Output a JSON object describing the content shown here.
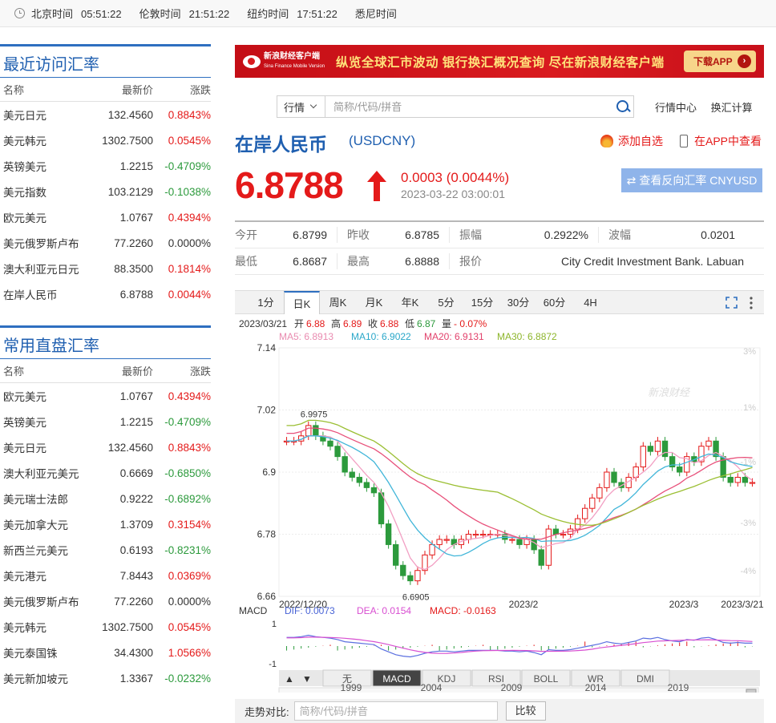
{
  "clock": [
    {
      "city": "北京时间",
      "time": "05:51:22"
    },
    {
      "city": "伦敦时间",
      "time": "21:51:22"
    },
    {
      "city": "纽约时间",
      "time": "17:51:22"
    },
    {
      "city": "悉尼时间",
      "time": ""
    }
  ],
  "recent": {
    "title": "最近访问汇率",
    "headers": [
      "名称",
      "最新价",
      "涨跌"
    ],
    "rows": [
      {
        "name": "美元日元",
        "price": "132.4560",
        "change": "0.8843%",
        "dir": "up"
      },
      {
        "name": "美元韩元",
        "price": "1302.7500",
        "change": "0.0545%",
        "dir": "up"
      },
      {
        "name": "英镑美元",
        "price": "1.2215",
        "change": "-0.4709%",
        "dir": "down"
      },
      {
        "name": "美元指数",
        "price": "103.2129",
        "change": "-0.1038%",
        "dir": "down"
      },
      {
        "name": "欧元美元",
        "price": "1.0767",
        "change": "0.4394%",
        "dir": "up"
      },
      {
        "name": "美元俄罗斯卢布",
        "price": "77.2260",
        "change": "0.0000%",
        "dir": "flat"
      },
      {
        "name": "澳大利亚元日元",
        "price": "88.3500",
        "change": "0.1814%",
        "dir": "up"
      },
      {
        "name": "在岸人民币",
        "price": "6.8788",
        "change": "0.0044%",
        "dir": "up"
      }
    ]
  },
  "common": {
    "title": "常用直盘汇率",
    "headers": [
      "名称",
      "最新价",
      "涨跌"
    ],
    "rows": [
      {
        "name": "欧元美元",
        "price": "1.0767",
        "change": "0.4394%",
        "dir": "up"
      },
      {
        "name": "英镑美元",
        "price": "1.2215",
        "change": "-0.4709%",
        "dir": "down"
      },
      {
        "name": "美元日元",
        "price": "132.4560",
        "change": "0.8843%",
        "dir": "up"
      },
      {
        "name": "澳大利亚元美元",
        "price": "0.6669",
        "change": "-0.6850%",
        "dir": "down"
      },
      {
        "name": "美元瑞士法郎",
        "price": "0.9222",
        "change": "-0.6892%",
        "dir": "down"
      },
      {
        "name": "美元加拿大元",
        "price": "1.3709",
        "change": "0.3154%",
        "dir": "up"
      },
      {
        "name": "新西兰元美元",
        "price": "0.6193",
        "change": "-0.8231%",
        "dir": "down"
      },
      {
        "name": "美元港元",
        "price": "7.8443",
        "change": "0.0369%",
        "dir": "up"
      },
      {
        "name": "美元俄罗斯卢布",
        "price": "77.2260",
        "change": "0.0000%",
        "dir": "flat"
      },
      {
        "name": "美元韩元",
        "price": "1302.7500",
        "change": "0.0545%",
        "dir": "up"
      },
      {
        "name": "美元泰国铢",
        "price": "34.4300",
        "change": "1.0566%",
        "dir": "up"
      },
      {
        "name": "美元新加坡元",
        "price": "1.3367",
        "change": "-0.0232%",
        "dir": "down"
      }
    ]
  },
  "banner": {
    "logo_line1": "新浪财经客户端",
    "logo_line2": "Sina Finance Mobile Version",
    "slogan": "纵览全球汇市波动 银行换汇概况查询 尽在新浪财经客户端",
    "download": "下载APP"
  },
  "search": {
    "select_label": "行情",
    "placeholder": "简称/代码/拼音",
    "link1": "行情中心",
    "link2": "换汇计算"
  },
  "quote": {
    "name": "在岸人民币",
    "code": "(USDCNY)",
    "add_fav": "添加自选",
    "app_view": "在APP中查看",
    "price": "6.8788",
    "change": "0.0003 (0.0044%)",
    "timestamp": "2023-03-22 03:00:01",
    "reverse_button": "查看反向汇率 CNYUSD"
  },
  "stats": {
    "row1": [
      {
        "label": "今开",
        "value": "6.8799"
      },
      {
        "label": "昨收",
        "value": "6.8785"
      },
      {
        "label": "振幅",
        "value": "0.2922%"
      },
      {
        "label": "波幅",
        "value": "0.0201"
      }
    ],
    "row2": [
      {
        "label": "最低",
        "value": "6.8687"
      },
      {
        "label": "最高",
        "value": "6.8888"
      },
      {
        "label": "报价",
        "value": "City Credit Investment Bank. Labuan"
      }
    ]
  },
  "chart_tabs": [
    "1分",
    "日K",
    "周K",
    "月K",
    "年K",
    "5分",
    "15分",
    "30分",
    "60分",
    "4H"
  ],
  "chart_active_tab": "日K",
  "chart_info": {
    "date": "2023/03/21",
    "open_label": "开",
    "open": "6.88",
    "high_label": "高",
    "high": "6.89",
    "close_label": "收",
    "close": "6.88",
    "low_label": "低",
    "low": "6.87",
    "amount_label": "量",
    "amount": "- 0.07%",
    "ma5": "MA5: 6.8913",
    "ma10": "MA10: 6.9022",
    "ma20": "MA20: 6.9131",
    "ma30": "MA30: 6.8872",
    "macd_title": "MACD",
    "dif": "DIF: 0.0073",
    "dea": "DEA: 0.0154",
    "macd": "MACD: -0.0163",
    "watermark": "新浪财经"
  },
  "indicator_tabs": [
    "无",
    "MACD",
    "KDJ",
    "RSI",
    "BOLL",
    "WR",
    "DMI"
  ],
  "indicator_active": "MACD",
  "compare": {
    "label": "走势对比:",
    "placeholder": "简称/代码/拼音",
    "button": "比较"
  },
  "chart_data": {
    "type": "line",
    "title": "",
    "y_ticks": [
      "7.14",
      "7.02",
      "6.9",
      "6.78",
      "6.66"
    ],
    "right_ticks": [
      "3%",
      "1%",
      "-1%",
      "-3%",
      "-4%"
    ],
    "x_ticks": [
      "2022/12/20",
      "2023/2",
      "2023/3",
      "2023/3/21"
    ],
    "ylim": [
      6.66,
      7.14
    ],
    "annotations": [
      {
        "label": "6.9975"
      },
      {
        "label": "6.6905"
      }
    ],
    "macd_ticks": [
      "1",
      "-1"
    ],
    "timeline_ticks": [
      "1999",
      "2004",
      "2009",
      "2014",
      "2019"
    ],
    "closes": [
      6.96,
      6.96,
      6.97,
      6.99,
      6.97,
      6.96,
      6.95,
      6.93,
      6.9,
      6.89,
      6.88,
      6.87,
      6.86,
      6.8,
      6.76,
      6.72,
      6.7,
      6.69,
      6.71,
      6.74,
      6.76,
      6.77,
      6.77,
      6.76,
      6.77,
      6.78,
      6.78,
      6.78,
      6.78,
      6.78,
      6.77,
      6.77,
      6.76,
      6.77,
      6.75,
      6.72,
      6.79,
      6.78,
      6.78,
      6.79,
      6.81,
      6.83,
      6.85,
      6.87,
      6.9,
      6.88,
      6.87,
      6.89,
      6.91,
      6.95,
      6.94,
      6.96,
      6.93,
      6.91,
      6.9,
      6.93,
      6.92,
      6.95,
      6.96,
      6.93,
      6.89,
      6.88,
      6.89,
      6.88,
      6.88
    ]
  }
}
